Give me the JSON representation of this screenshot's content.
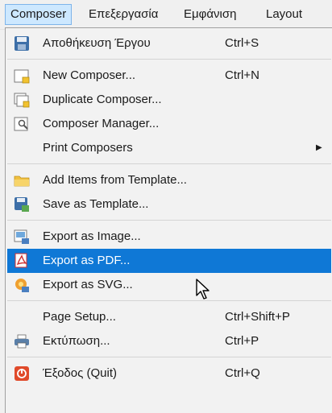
{
  "menubar": {
    "items": [
      "Composer",
      "Επεξεργασία",
      "Εμφάνιση",
      "Layout"
    ]
  },
  "menu": {
    "items": [
      {
        "label": "Αποθήκευση Έργου",
        "shortcut": "Ctrl+S",
        "icon": "save-icon"
      },
      {
        "label": "New Composer...",
        "shortcut": "Ctrl+N",
        "icon": "new-composer-icon"
      },
      {
        "label": "Duplicate Composer...",
        "shortcut": "",
        "icon": "duplicate-composer-icon"
      },
      {
        "label": "Composer Manager...",
        "shortcut": "",
        "icon": "composer-manager-icon"
      },
      {
        "label": "Print Composers",
        "shortcut": "",
        "icon": "",
        "submenu": true
      },
      {
        "label": "Add Items from Template...",
        "shortcut": "",
        "icon": "folder-icon"
      },
      {
        "label": "Save as Template...",
        "shortcut": "",
        "icon": "save-template-icon"
      },
      {
        "label": "Export as Image...",
        "shortcut": "",
        "icon": "export-image-icon"
      },
      {
        "label": "Export as PDF...",
        "shortcut": "",
        "icon": "pdf-icon",
        "highlighted": true
      },
      {
        "label": "Export as SVG...",
        "shortcut": "",
        "icon": "svg-icon"
      },
      {
        "label": "Page Setup...",
        "shortcut": "Ctrl+Shift+P",
        "icon": ""
      },
      {
        "label": "Εκτύπωση...",
        "shortcut": "Ctrl+P",
        "icon": "printer-icon"
      },
      {
        "label": "Έξοδος (Quit)",
        "shortcut": "Ctrl+Q",
        "icon": "quit-icon"
      }
    ]
  },
  "colors": {
    "menu_background": "#f2f2f2",
    "highlight": "#0f78d6",
    "active_menubar": "#cde8ff"
  }
}
